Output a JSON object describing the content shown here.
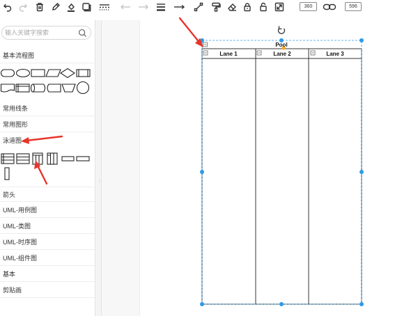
{
  "toolbar": {
    "items": [
      {
        "name": "undo-icon",
        "enabled": true
      },
      {
        "name": "redo-icon",
        "enabled": false
      },
      {
        "name": "delete-icon",
        "enabled": true
      },
      {
        "name": "pen-icon",
        "enabled": true
      },
      {
        "name": "fill-color-icon",
        "enabled": true
      },
      {
        "name": "shadow-icon",
        "enabled": true
      },
      {
        "name": "dash-line-icon",
        "enabled": true
      },
      {
        "name": "arrow-left-icon",
        "enabled": false
      },
      {
        "name": "arrow-right-icon",
        "enabled": false
      },
      {
        "name": "line-weight-icon",
        "enabled": true
      },
      {
        "name": "connector-arrow-icon",
        "enabled": true
      },
      {
        "name": "waypoint-icon",
        "enabled": true
      },
      {
        "name": "format-painter-icon",
        "enabled": true
      },
      {
        "name": "eraser-icon",
        "enabled": true
      },
      {
        "name": "lock-icon",
        "enabled": true
      },
      {
        "name": "unlock-icon",
        "enabled": true
      },
      {
        "name": "fullscreen-icon",
        "enabled": true
      }
    ],
    "rotate_value": "360",
    "link_icon": "link-icon",
    "size_value": "596"
  },
  "sidebar": {
    "search_placeholder": "输入关键字搜索",
    "sections": {
      "basic_flowchart": "基本流程图",
      "common_lines": "常用线条",
      "common_shapes": "常用图形",
      "swimlane": "泳道图",
      "arrows": "箭头",
      "uml_usecase": "UML-用例图",
      "uml_class": "UML-类图",
      "uml_sequence": "UML-时序图",
      "uml_component": "UML-组件图",
      "basic": "基本",
      "clipart": "剪贴画"
    }
  },
  "canvas": {
    "pool_title": "Pool",
    "lanes": [
      "Lane 1",
      "Lane 2",
      "Lane 3"
    ],
    "annotation_color": "#e8342a",
    "selection_color": "#2c9ae8"
  }
}
